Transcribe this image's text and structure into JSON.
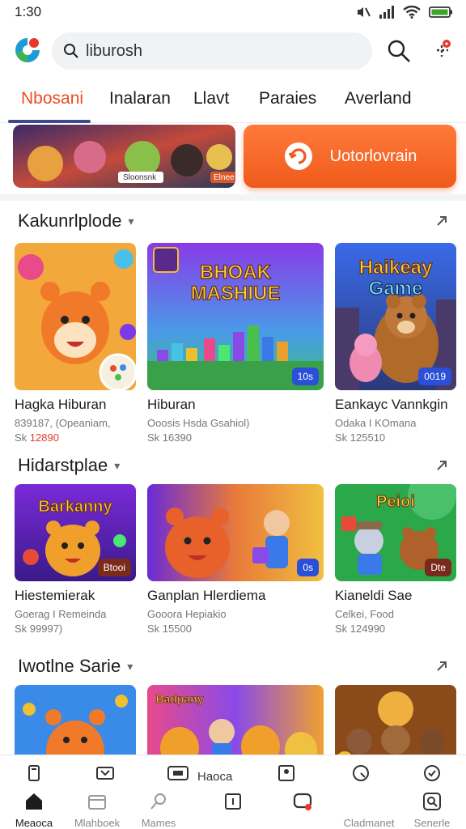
{
  "status_bar": {
    "time": "1:30"
  },
  "search": {
    "value": "liburosh"
  },
  "tabs": [
    {
      "label": "Nbosani",
      "active": true
    },
    {
      "label": "Inalaran",
      "active": false
    },
    {
      "label": "Llavt",
      "active": false
    },
    {
      "label": "Paraies",
      "active": false
    },
    {
      "label": "Averland",
      "active": false
    }
  ],
  "promo": {
    "button_label": "Uotorlovrain",
    "banner_badge": "Elnee",
    "banner_text": "Sloonsnk"
  },
  "sections": [
    {
      "title": "Kakunrlplode",
      "cards": [
        {
          "name": "Hagka Hiburan",
          "sub": "839187, (Opeaniam,",
          "price_prefix": "Sk ",
          "price_highlight": "12890",
          "thumb_text": "",
          "badge": ""
        },
        {
          "name": "Hiburan",
          "sub": "Ooosis Hsda Gsahiol)",
          "price_prefix": "Sk 16390",
          "price_highlight": "",
          "thumb_text": "BHOAK MASHIUE",
          "badge": "10s"
        },
        {
          "name": "Eankayc Vannkgin",
          "sub": "Odaka I KOmana",
          "price_prefix": "Sk 125510",
          "price_highlight": "",
          "thumb_text": "Haikeay Game",
          "badge": "0019"
        }
      ]
    },
    {
      "title": "Hidarstplae",
      "cards": [
        {
          "name": "Hiestemierak",
          "sub": "Goerag I Remeinda",
          "price_prefix": "Sk 99997)",
          "price_highlight": "",
          "thumb_text": "Barkanny",
          "badge": "Btooi"
        },
        {
          "name": "Ganplan Hlerdiema",
          "sub": "Gooora Hepiakio",
          "price_prefix": "Sk 15500",
          "price_highlight": "",
          "thumb_text": "",
          "badge": "0s"
        },
        {
          "name": "Kianeldi Sae",
          "sub": "Celkei, Food",
          "price_prefix": "Sk 124990",
          "price_highlight": "",
          "thumb_text": "Peioi",
          "badge": "Dte"
        }
      ]
    },
    {
      "title": "Iwotlne Sarie",
      "cards": [
        {
          "thumb_text": ""
        },
        {
          "thumb_text": "Badpany"
        },
        {
          "thumb_text": ""
        }
      ]
    }
  ],
  "bottom_nav": {
    "mid_label": "Haoca",
    "items": [
      {
        "label": "Meaoca",
        "icon": "home-icon",
        "active": true
      },
      {
        "label": "Mlahboek",
        "icon": "wallet-icon",
        "active": false
      },
      {
        "label": "Mames",
        "icon": "search-icon",
        "active": false
      },
      {
        "label": "",
        "icon": "square-icon",
        "active": false
      },
      {
        "label": "",
        "icon": "chat-icon",
        "active": false
      },
      {
        "label": "Cladmanet",
        "icon": "bolt-icon",
        "active": false
      },
      {
        "label": "Senerle",
        "icon": "profile-search-icon",
        "active": false
      }
    ]
  },
  "colors": {
    "accent": "#f04a1e",
    "tab_underline": "#3e4a8a",
    "badge_blue": "#2a4fd8"
  }
}
